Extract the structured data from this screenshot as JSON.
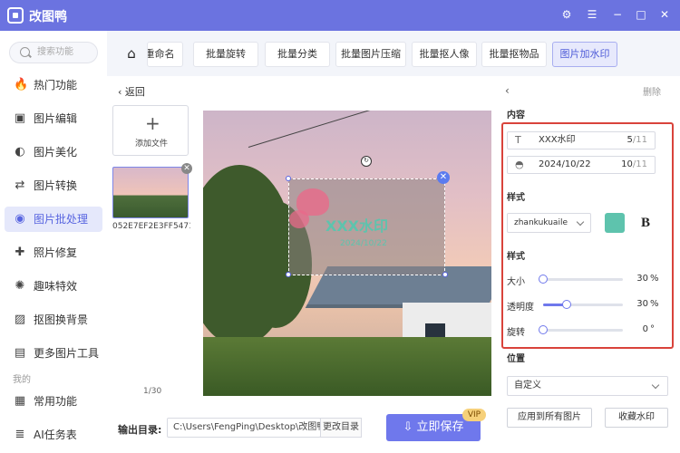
{
  "app": {
    "title": "改图鸭"
  },
  "window": {
    "skin_icon": "⚙",
    "menu_icon": "☰",
    "minimize_icon": "−",
    "maximize_icon": "□",
    "close_icon": "✕"
  },
  "sidebar": {
    "search_placeholder": "搜索功能",
    "items": [
      {
        "label": "热门功能",
        "icon": "🔥",
        "active": false
      },
      {
        "label": "图片编辑",
        "icon": "▣",
        "active": false
      },
      {
        "label": "图片美化",
        "icon": "◐",
        "active": false
      },
      {
        "label": "图片转换",
        "icon": "⇄",
        "active": false
      },
      {
        "label": "图片批处理",
        "icon": "◉",
        "active": true
      },
      {
        "label": "照片修复",
        "icon": "✚",
        "active": false
      },
      {
        "label": "趣味特效",
        "icon": "✺",
        "active": false
      },
      {
        "label": "抠图换背景",
        "icon": "▨",
        "active": false
      },
      {
        "label": "更多图片工具",
        "icon": "▤",
        "active": false
      }
    ],
    "section_label": "我的",
    "my_items": [
      {
        "label": "常用功能",
        "icon": "▦"
      },
      {
        "label": "AI任务表",
        "icon": "≣"
      }
    ]
  },
  "toolbar": {
    "home_icon": "⌂",
    "tabs": [
      {
        "label": "批量重命名",
        "active": false
      },
      {
        "label": "批量旋转",
        "active": false
      },
      {
        "label": "批量分类",
        "active": false
      },
      {
        "label": "批量图片压缩",
        "active": false
      },
      {
        "label": "批量抠人像",
        "active": false
      },
      {
        "label": "批量抠物品",
        "active": false
      },
      {
        "label": "图片加水印",
        "active": true
      }
    ]
  },
  "main": {
    "back_label": "返回",
    "add_file_label": "添加文件",
    "file_name": "052E7EF2E3FF5471...",
    "page_counter": "1/30",
    "watermark_text": "XXX水印",
    "watermark_date": "2024/10/22"
  },
  "footer": {
    "output_label": "输出目录:",
    "output_path": "C:\\Users\\FengPing\\Desktop\\改图鸭",
    "change_dir_label": "更改目录",
    "save_label": "立即保存",
    "vip_label": "VIP"
  },
  "panel": {
    "delete_label": "删除",
    "content_section": "内容",
    "text_field": {
      "value": "XXX水印",
      "count": "5",
      "max": "/11"
    },
    "date_field": {
      "value": "2024/10/22",
      "count": "10",
      "max": "/11"
    },
    "style_section": "样式",
    "font_name": "zhankukuaile",
    "color": "#5ec3ad",
    "bold_label": "B",
    "style_section2": "样式",
    "sliders": [
      {
        "label": "大小",
        "value": "30",
        "unit": "%",
        "fraction": 0.0
      },
      {
        "label": "透明度",
        "value": "30",
        "unit": "%",
        "fraction": 0.3
      },
      {
        "label": "旋转",
        "value": "0",
        "unit": "°",
        "fraction": 0.0
      }
    ],
    "position_section": "位置",
    "position_value": "自定义",
    "apply_all_label": "应用到所有图片",
    "collect_label": "收藏水印"
  }
}
